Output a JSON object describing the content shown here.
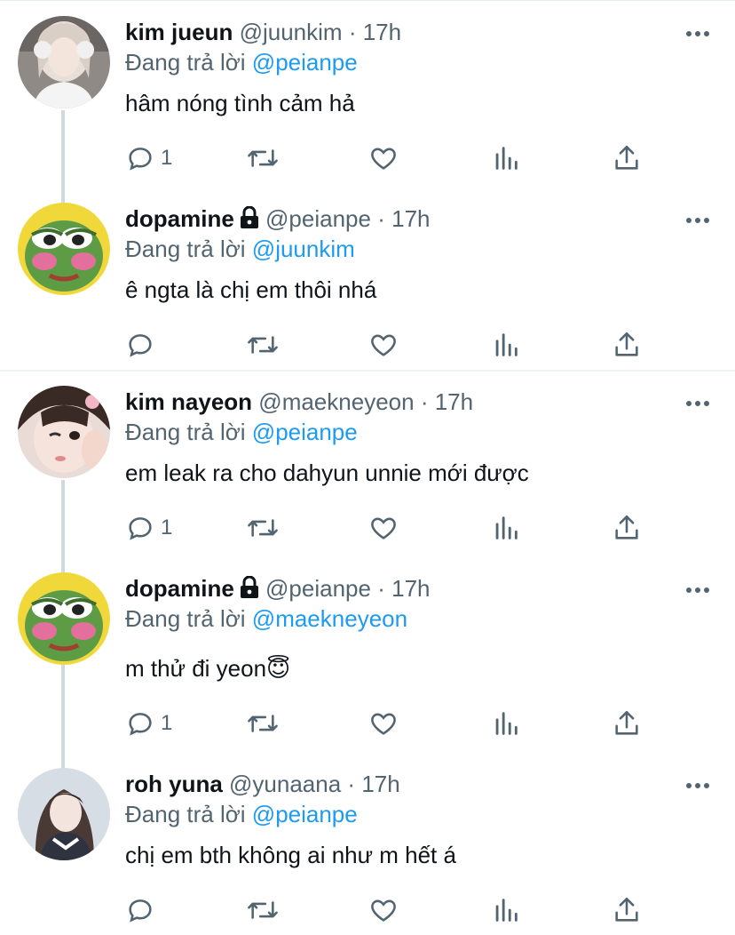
{
  "reply_prefix": "Đang trả lời",
  "tweets": [
    {
      "name": "kim jueun",
      "handle": "@juunkim",
      "sep": "·",
      "time": "17h",
      "locked": false,
      "reply_to": "@peianpe",
      "text": "hâm nóng tình cảm hả",
      "reply_count": "1",
      "avatar": "girl-white-headphones"
    },
    {
      "name": "dopamine",
      "handle": "@peianpe",
      "sep": "·",
      "time": "17h",
      "locked": true,
      "reply_to": "@juunkim",
      "text": "ê ngta là chị em thôi nhá",
      "reply_count": "",
      "avatar": "pepe-blushing"
    },
    {
      "name": "kim nayeon",
      "handle": "@maekneyeon",
      "sep": "·",
      "time": "17h",
      "locked": false,
      "reply_to": "@peianpe",
      "text": "em leak ra cho dahyun unnie mới được",
      "reply_count": "1",
      "avatar": "girl-winking"
    },
    {
      "name": "dopamine",
      "handle": "@peianpe",
      "sep": "·",
      "time": "17h",
      "locked": true,
      "reply_to": "@maekneyeon",
      "text": "m thử đi yeon😇",
      "reply_count": "1",
      "avatar": "pepe-blushing"
    },
    {
      "name": "roh yuna",
      "handle": "@yunaana",
      "sep": "·",
      "time": "17h",
      "locked": false,
      "reply_to": "@peianpe",
      "text": "chị em bth không ai như m hết á",
      "reply_count": "",
      "avatar": "girl-long-hair"
    }
  ],
  "icons": {
    "reply": "reply-icon",
    "retweet": "retweet-icon",
    "like": "heart-icon",
    "views": "analytics-icon",
    "share": "share-icon",
    "more": "more-icon",
    "lock": "lock-icon"
  },
  "colors": {
    "mention": "#1d9bf0",
    "secondary_text": "#536471",
    "thread_line": "#cfd9de"
  }
}
